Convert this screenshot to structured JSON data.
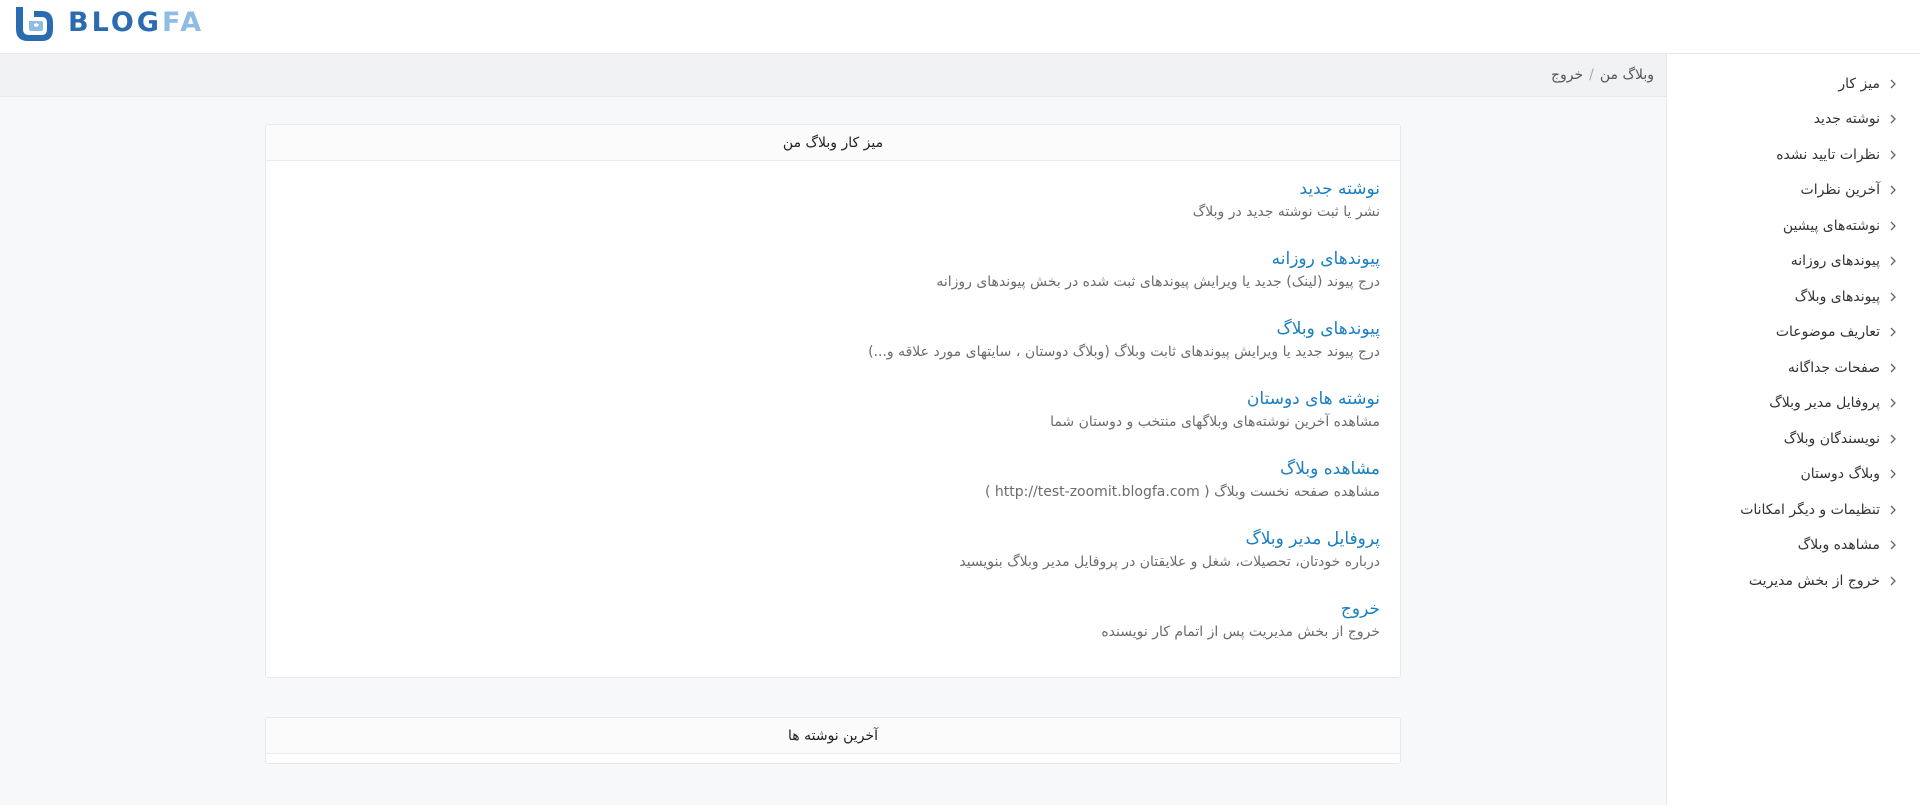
{
  "brand": {
    "name_part1": "BLOG",
    "name_part2": "FA",
    "color_primary": "#2b6cb0",
    "color_secondary": "#8fbce3"
  },
  "breadcrumb": {
    "root": "وبلاگ من",
    "separator": "/",
    "current": "خروج"
  },
  "sidebar": {
    "items": [
      {
        "label": "میز کار"
      },
      {
        "label": "نوشته جدید"
      },
      {
        "label": "نظرات تایید نشده"
      },
      {
        "label": "آخرین نظرات"
      },
      {
        "label": "نوشته‌های پیشین"
      },
      {
        "label": "پیوندهای روزانه"
      },
      {
        "label": "پیوندهای وبلاگ"
      },
      {
        "label": "تعاریف موضوعات"
      },
      {
        "label": "صفحات جداگانه"
      },
      {
        "label": "پروفایل مدیر وبلاگ"
      },
      {
        "label": "نویسندگان وبلاگ"
      },
      {
        "label": "وبلاگ دوستان"
      },
      {
        "label": "تنظیمات و دیگر امکانات"
      },
      {
        "label": "مشاهده وبلاگ"
      },
      {
        "label": "خروج از بخش مدیریت"
      }
    ]
  },
  "dashboard": {
    "title": "میز کار وبلاگ من",
    "items": [
      {
        "title": "نوشته جدید",
        "desc": "نشر یا ثبت نوشته جدید در وبلاگ"
      },
      {
        "title": "پیوندهای روزانه",
        "desc": "درج پیوند (لینک) جدید یا ویرایش پیوندهای ثبت شده در بخش پیوندهای روزانه"
      },
      {
        "title": "پیوندهای وبلاگ",
        "desc": "درج پیوند جدید یا ویرایش پیوندهای ثابت وبلاگ (وبلاگ دوستان ، سایتهای مورد علاقه و...)"
      },
      {
        "title": "نوشته های دوستان",
        "desc": "مشاهده آخرین نوشته‌های وبلاگهای منتخب و دوستان شما"
      },
      {
        "title": "مشاهده وبلاگ",
        "desc": "مشاهده صفحه نخست وبلاگ ( http://test-zoomit.blogfa.com )"
      },
      {
        "title": "پروفایل مدیر وبلاگ",
        "desc": "درباره خودتان، تحصیلات، شغل و علایقتان در پروفایل مدیر وبلاگ بنویسید"
      },
      {
        "title": "خروج",
        "desc": "خروج از بخش مدیریت پس از اتمام کار نویسنده"
      }
    ]
  },
  "latest_posts": {
    "title": "آخرین نوشته ها"
  }
}
